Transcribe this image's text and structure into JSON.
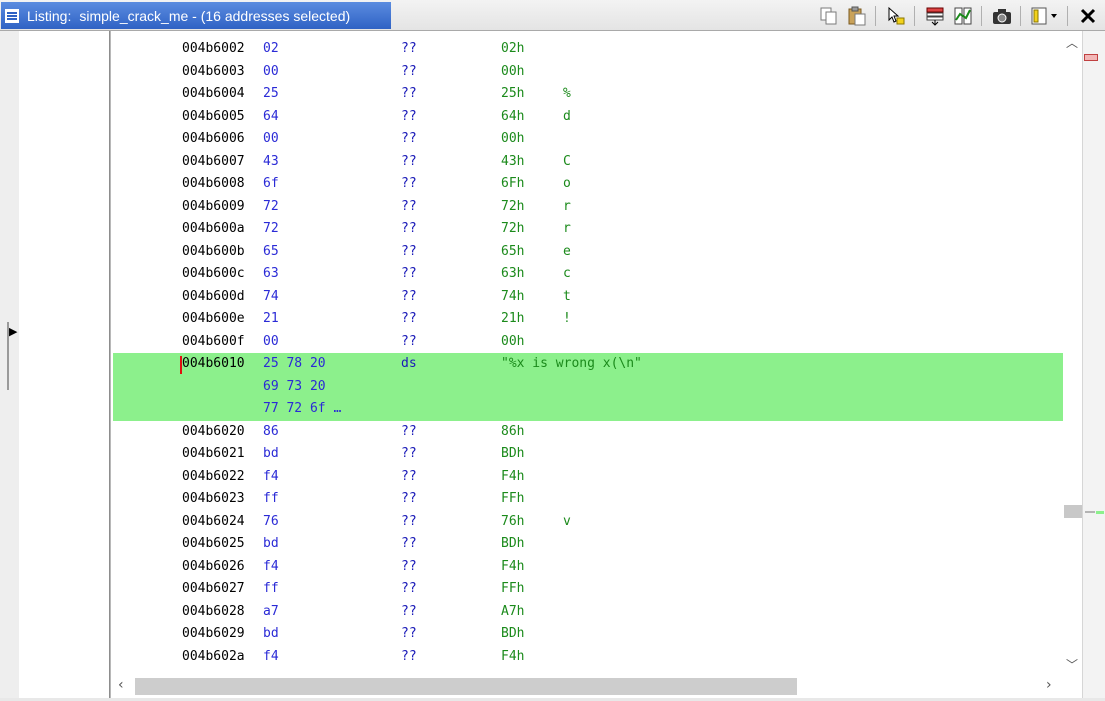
{
  "window": {
    "title_label": "Listing:",
    "title_file": "simple_crack_me - (16 addresses selected)"
  },
  "toolbar": {
    "buttons": [
      {
        "name": "copy-icon"
      },
      {
        "name": "paste-icon"
      },
      {
        "name": "cursor-select-icon"
      },
      {
        "name": "field-layout-icon"
      },
      {
        "name": "diff-view-icon"
      },
      {
        "name": "snapshot-camera-icon"
      },
      {
        "name": "options-menu-icon"
      },
      {
        "name": "close-icon"
      }
    ]
  },
  "listing": {
    "rows": [
      {
        "addr": "004b6002",
        "bytes": "02",
        "mnem": "??",
        "val": "02h",
        "chr": ""
      },
      {
        "addr": "004b6003",
        "bytes": "00",
        "mnem": "??",
        "val": "00h",
        "chr": ""
      },
      {
        "addr": "004b6004",
        "bytes": "25",
        "mnem": "??",
        "val": "25h",
        "chr": "%"
      },
      {
        "addr": "004b6005",
        "bytes": "64",
        "mnem": "??",
        "val": "64h",
        "chr": "d"
      },
      {
        "addr": "004b6006",
        "bytes": "00",
        "mnem": "??",
        "val": "00h",
        "chr": ""
      },
      {
        "addr": "004b6007",
        "bytes": "43",
        "mnem": "??",
        "val": "43h",
        "chr": "C"
      },
      {
        "addr": "004b6008",
        "bytes": "6f",
        "mnem": "??",
        "val": "6Fh",
        "chr": "o"
      },
      {
        "addr": "004b6009",
        "bytes": "72",
        "mnem": "??",
        "val": "72h",
        "chr": "r"
      },
      {
        "addr": "004b600a",
        "bytes": "72",
        "mnem": "??",
        "val": "72h",
        "chr": "r"
      },
      {
        "addr": "004b600b",
        "bytes": "65",
        "mnem": "??",
        "val": "65h",
        "chr": "e"
      },
      {
        "addr": "004b600c",
        "bytes": "63",
        "mnem": "??",
        "val": "63h",
        "chr": "c"
      },
      {
        "addr": "004b600d",
        "bytes": "74",
        "mnem": "??",
        "val": "74h",
        "chr": "t"
      },
      {
        "addr": "004b600e",
        "bytes": "21",
        "mnem": "??",
        "val": "21h",
        "chr": "!"
      },
      {
        "addr": "004b600f",
        "bytes": "00",
        "mnem": "??",
        "val": "00h",
        "chr": ""
      }
    ],
    "selected": {
      "addr": "004b6010",
      "bytes_line1": "25 78 20",
      "bytes_line2": "69 73 20",
      "bytes_line3": "77 72 6f …",
      "mnem": "ds",
      "val": "\"%x is wrong x(\\n\""
    },
    "rows_after": [
      {
        "addr": "004b6020",
        "bytes": "86",
        "mnem": "??",
        "val": "86h",
        "chr": ""
      },
      {
        "addr": "004b6021",
        "bytes": "bd",
        "mnem": "??",
        "val": "BDh",
        "chr": ""
      },
      {
        "addr": "004b6022",
        "bytes": "f4",
        "mnem": "??",
        "val": "F4h",
        "chr": ""
      },
      {
        "addr": "004b6023",
        "bytes": "ff",
        "mnem": "??",
        "val": "FFh",
        "chr": ""
      },
      {
        "addr": "004b6024",
        "bytes": "76",
        "mnem": "??",
        "val": "76h",
        "chr": "v"
      },
      {
        "addr": "004b6025",
        "bytes": "bd",
        "mnem": "??",
        "val": "BDh",
        "chr": ""
      },
      {
        "addr": "004b6026",
        "bytes": "f4",
        "mnem": "??",
        "val": "F4h",
        "chr": ""
      },
      {
        "addr": "004b6027",
        "bytes": "ff",
        "mnem": "??",
        "val": "FFh",
        "chr": ""
      },
      {
        "addr": "004b6028",
        "bytes": "a7",
        "mnem": "??",
        "val": "A7h",
        "chr": ""
      },
      {
        "addr": "004b6029",
        "bytes": "bd",
        "mnem": "??",
        "val": "BDh",
        "chr": ""
      },
      {
        "addr": "004b602a",
        "bytes": "f4",
        "mnem": "??",
        "val": "F4h",
        "chr": ""
      }
    ]
  },
  "colors": {
    "selection": "#8cf08c",
    "title_bar": "#3a6fd0",
    "address": "#000000",
    "bytes": "#2a2ad6",
    "value": "#1b8a1b"
  }
}
